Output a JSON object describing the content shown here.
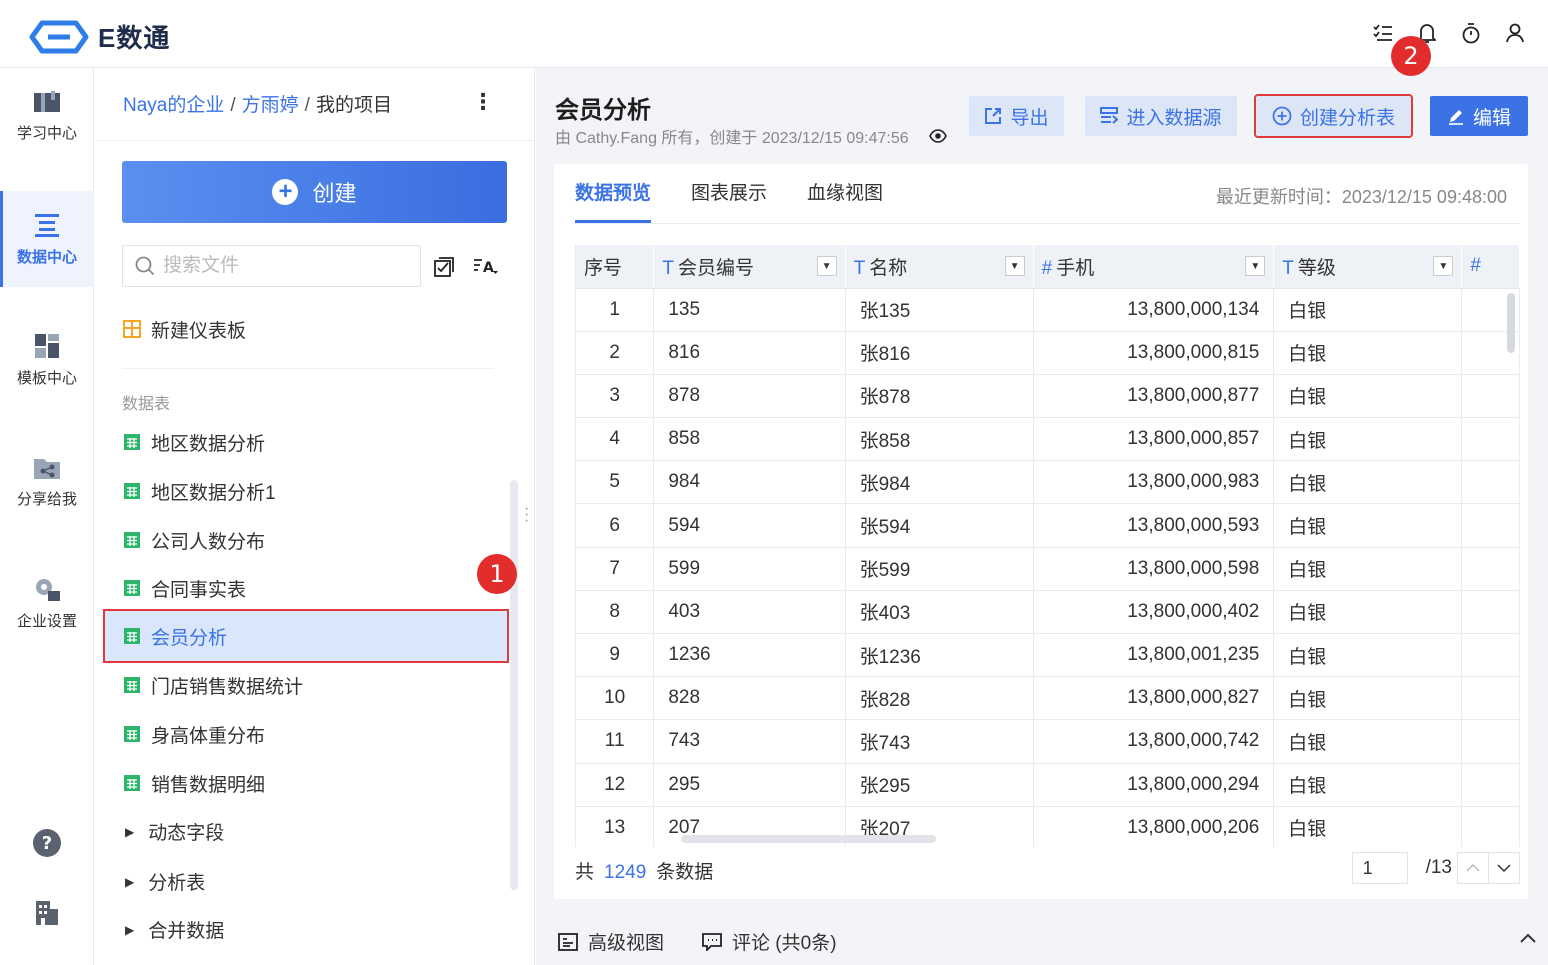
{
  "app": {
    "logo_text": "E数通"
  },
  "rail": {
    "items": [
      {
        "label": "学习中心",
        "icon": "book-icon"
      },
      {
        "label": "数据中心",
        "icon": "list-icon"
      },
      {
        "label": "模板中心",
        "icon": "dashboard-icon"
      },
      {
        "label": "分享给我",
        "icon": "share-icon"
      },
      {
        "label": "企业设置",
        "icon": "gear-icon"
      }
    ]
  },
  "breadcrumb": {
    "org": "Naya的企业",
    "user": "方雨婷",
    "project": "我的项目",
    "sep": "/"
  },
  "filepanel": {
    "create_label": "创建",
    "search_placeholder": "搜索文件",
    "dashboard_item": "新建仪表板",
    "section_label": "数据表",
    "tables": [
      "地区数据分析",
      "地区数据分析1",
      "公司人数分布",
      "合同事实表",
      "会员分析",
      "门店销售数据统计",
      "身高体重分布",
      "销售数据明细"
    ],
    "folders": [
      "动态字段",
      "分析表",
      "合并数据"
    ]
  },
  "badges": {
    "one": "1",
    "two": "2"
  },
  "header": {
    "title": "会员分析",
    "subtitle": "由 Cathy.Fang 所有，创建于 2023/12/15 09:47:56",
    "export_label": "导出",
    "datasource_label": "进入数据源",
    "create_analysis_label": "创建分析表",
    "edit_label": "编辑"
  },
  "tabs": [
    "数据预览",
    "图表展示",
    "血缘视图"
  ],
  "updated": "最近更新时间：2023/12/15 09:48:00",
  "table": {
    "columns": [
      {
        "type": "",
        "name": "序号"
      },
      {
        "type": "T",
        "name": "会员编号"
      },
      {
        "type": "T",
        "name": "名称"
      },
      {
        "type": "#",
        "name": "手机"
      },
      {
        "type": "T",
        "name": "等级"
      },
      {
        "type": "#",
        "name": ""
      }
    ],
    "rows": [
      [
        "1",
        "135",
        "张135",
        "13,800,000,134",
        "白银"
      ],
      [
        "2",
        "816",
        "张816",
        "13,800,000,815",
        "白银"
      ],
      [
        "3",
        "878",
        "张878",
        "13,800,000,877",
        "白银"
      ],
      [
        "4",
        "858",
        "张858",
        "13,800,000,857",
        "白银"
      ],
      [
        "5",
        "984",
        "张984",
        "13,800,000,983",
        "白银"
      ],
      [
        "6",
        "594",
        "张594",
        "13,800,000,593",
        "白银"
      ],
      [
        "7",
        "599",
        "张599",
        "13,800,000,598",
        "白银"
      ],
      [
        "8",
        "403",
        "张403",
        "13,800,000,402",
        "白银"
      ],
      [
        "9",
        "1236",
        "张1236",
        "13,800,001,235",
        "白银"
      ],
      [
        "10",
        "828",
        "张828",
        "13,800,000,827",
        "白银"
      ],
      [
        "11",
        "743",
        "张743",
        "13,800,000,742",
        "白银"
      ],
      [
        "12",
        "295",
        "张295",
        "13,800,000,294",
        "白银"
      ],
      [
        "13",
        "207",
        "张207",
        "13,800,000,206",
        "白银"
      ]
    ]
  },
  "footer": {
    "total_prefix": "共",
    "total_count": "1249",
    "total_suffix": "条数据",
    "page_value": "1",
    "page_total": "/13"
  },
  "bottombar": {
    "advanced_view": "高级视图",
    "comments": "评论 (共0条)"
  },
  "colors": {
    "accent": "#3b73e6",
    "highlight_red": "#e0393e",
    "badge_red": "#e32d2d",
    "green_icon": "#2db56b",
    "orange_icon": "#f5a623"
  }
}
